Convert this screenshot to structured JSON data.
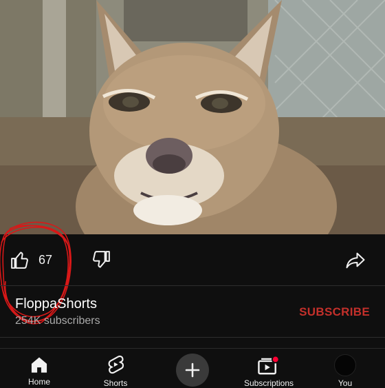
{
  "video": {
    "subject": "caracal"
  },
  "actions": {
    "like_count": "67",
    "like_icon": "thumbs-up-icon",
    "dislike_icon": "thumbs-down-icon",
    "share_icon": "share-arrow-icon"
  },
  "channel": {
    "name": "FloppaShorts",
    "subscribers": "254K subscribers",
    "subscribe_label": "SUBSCRIBE"
  },
  "nav": {
    "items": [
      {
        "label": "Home",
        "icon": "home-icon"
      },
      {
        "label": "Shorts",
        "icon": "shorts-icon"
      },
      {
        "label": "",
        "icon": "plus-icon"
      },
      {
        "label": "Subscriptions",
        "icon": "subscriptions-icon"
      },
      {
        "label": "You",
        "icon": "avatar"
      }
    ]
  },
  "colors": {
    "background": "#0f0f0f",
    "subscribe": "#c4302b",
    "annotation": "#d81818"
  }
}
